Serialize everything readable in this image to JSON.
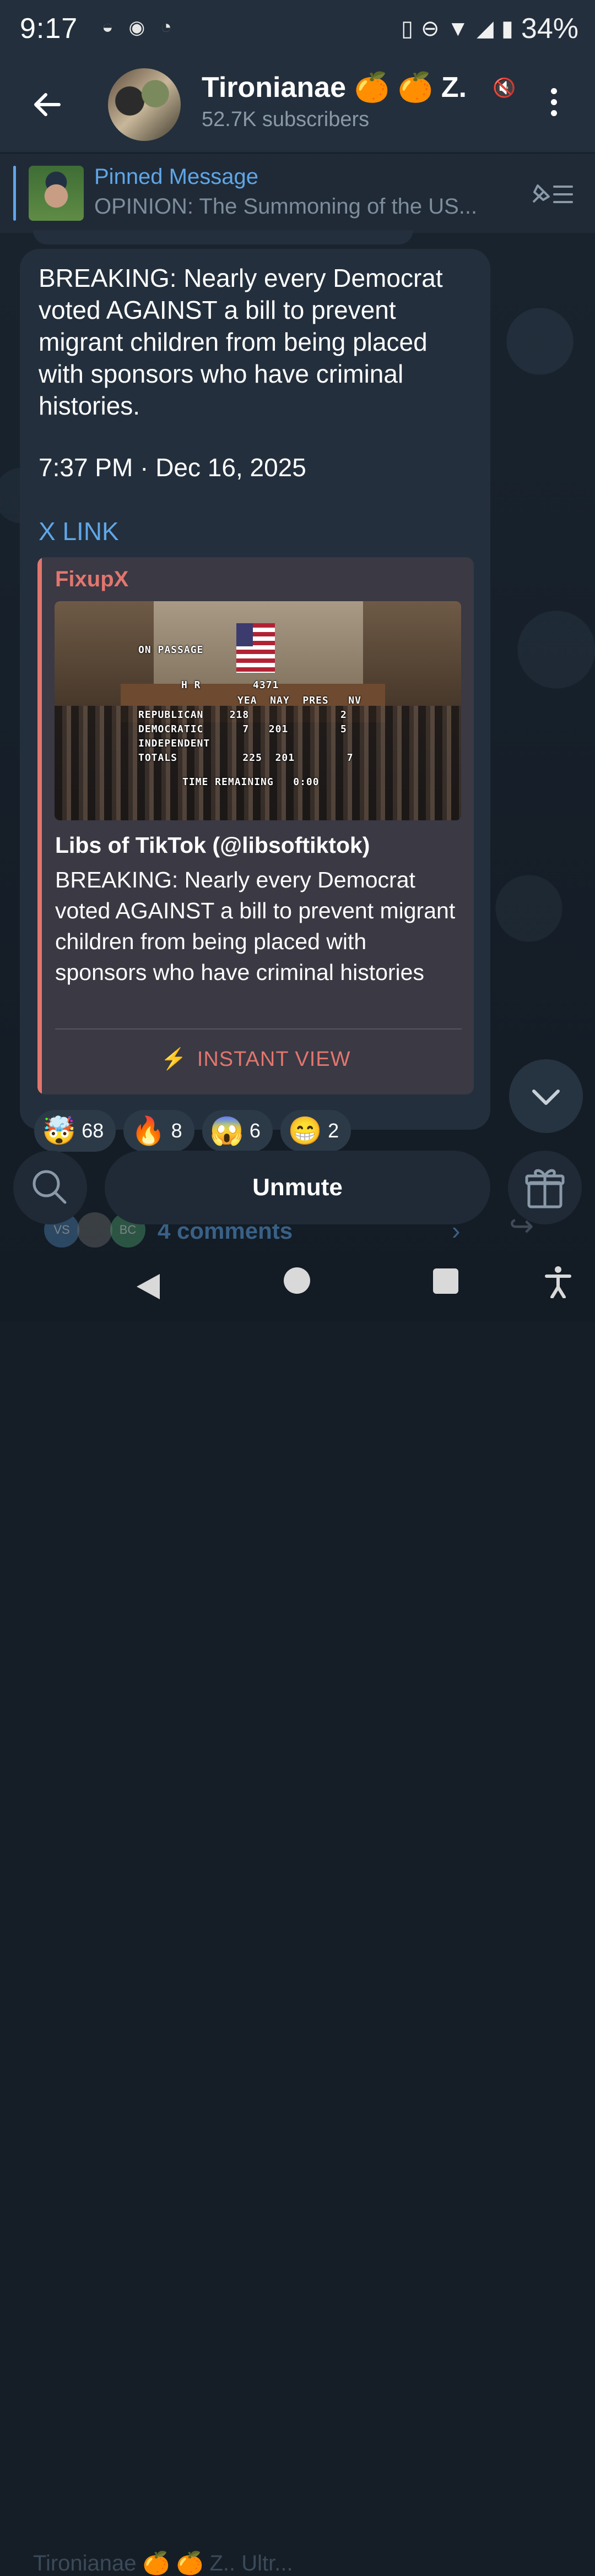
{
  "status_bar": {
    "time": "9:17",
    "battery": "34%"
  },
  "header": {
    "title": "Tironianae 🍊 🍊 Z.",
    "subtitle": "52.7K subscribers"
  },
  "pinned": {
    "label": "Pinned Message",
    "text": "OPINION: The Summoning of the US..."
  },
  "message": {
    "text": "BREAKING: Nearly every Democrat voted AGAINST a bill to prevent migrant children from being placed with sponsors who have criminal histories.",
    "date": "7:37 PM · Dec 16, 2025",
    "link_label": "X LINK",
    "preview": {
      "site": "FixupX",
      "image_overlay": {
        "on_passage": "ON PASSAGE",
        "hr": "H R",
        "bill": "4371",
        "cols": "YEA  NAY  PRES   NV",
        "republican": "REPUBLICAN    218              2",
        "democratic": "DEMOCRATIC      7   201        5",
        "independent": "INDEPENDENT",
        "totals": "TOTALS          225  201        7",
        "time_remaining": "TIME REMAINING   0:00"
      },
      "title": "Libs of TikTok (@libsoftiktok)",
      "description": "BREAKING: Nearly every Democrat voted AGAINST a bill to prevent migrant children from being placed with sponsors who have criminal histories",
      "instant_view": "INSTANT VIEW"
    }
  },
  "reactions": [
    {
      "emoji": "🤯",
      "count": "68"
    },
    {
      "emoji": "🔥",
      "count": "8"
    },
    {
      "emoji": "😱",
      "count": "6"
    },
    {
      "emoji": "😁",
      "count": "2"
    }
  ],
  "comments": {
    "avatars": [
      "VS",
      "",
      "BC"
    ],
    "label": "4 comments"
  },
  "bottom_bar": {
    "unmute_label": "Unmute"
  },
  "peek_message": "Tironianae 🍊 🍊 Z.. Ultr...",
  "colors": {
    "accent": "#5fa6e8",
    "preview_accent": "#e2766e",
    "bubble": "#232f3c",
    "background": "#151e27"
  },
  "icons": {
    "back": "arrow-left-icon",
    "more": "kebab-icon",
    "mute": "muted-speaker-icon",
    "pin_list": "pin-list-icon",
    "scroll_down": "chevron-down-icon",
    "search": "search-icon",
    "gift": "gift-icon",
    "share": "share-icon"
  }
}
